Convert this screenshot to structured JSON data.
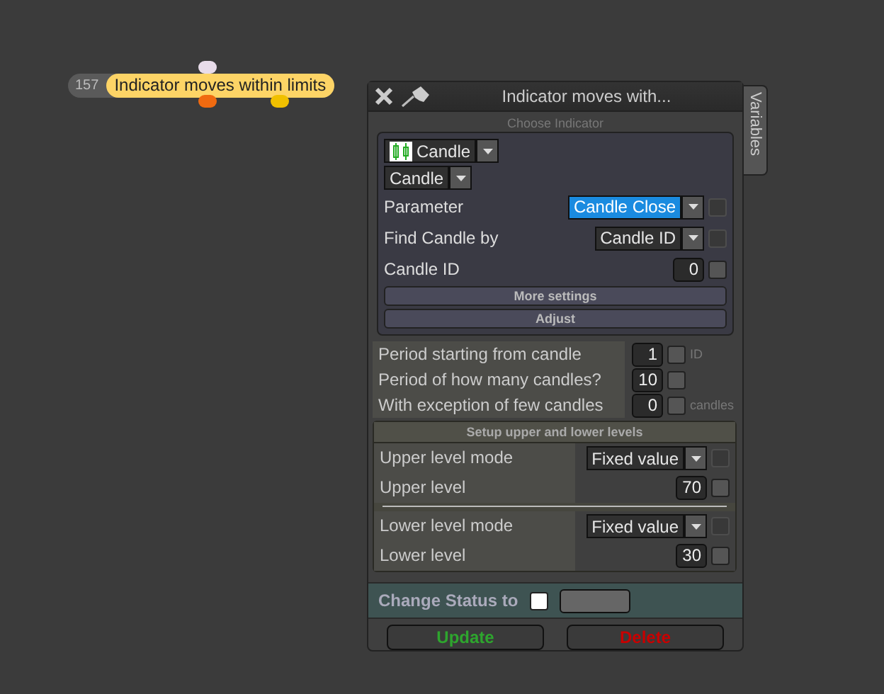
{
  "node": {
    "number": "157",
    "label": "Indicator moves within limits"
  },
  "panel": {
    "title": "Indicator moves with...",
    "side_tab": "Variables"
  },
  "indicator": {
    "caption": "Choose Indicator",
    "selects": [
      "Candle",
      "Candle"
    ],
    "rows": [
      {
        "kind": "dropdown",
        "label": "Parameter",
        "value": "Candle Close",
        "focused": true,
        "disabled": true
      },
      {
        "kind": "dropdown",
        "label": "Find Candle by",
        "value": "Candle ID",
        "focused": false,
        "disabled": true
      },
      {
        "kind": "number",
        "label": "Candle ID",
        "value": "0",
        "checked": false
      }
    ],
    "buttons": [
      "More settings",
      "Adjust"
    ]
  },
  "period": [
    {
      "label": "Period starting from candle",
      "value": "1",
      "checked": false,
      "unit": "ID"
    },
    {
      "label": "Period of how many candles?",
      "value": "10",
      "checked": false
    },
    {
      "label": "With exception of few candles",
      "value": "0",
      "checked": false,
      "unit": "candles"
    }
  ],
  "levels": {
    "title": "Setup upper and lower levels",
    "groups": [
      [
        {
          "kind": "dropdown",
          "label": "Upper level mode",
          "value": "Fixed value",
          "focused": false,
          "disabled": true
        },
        {
          "kind": "number",
          "label": "Upper level",
          "value": "70",
          "checked": false
        }
      ],
      [
        {
          "kind": "dropdown",
          "label": "Lower level mode",
          "value": "Fixed value",
          "focused": false,
          "disabled": true
        },
        {
          "kind": "number",
          "label": "Lower level",
          "value": "30",
          "checked": false
        }
      ]
    ]
  },
  "status": {
    "label": "Change Status to",
    "checked": false
  },
  "actions": [
    {
      "kind": "update",
      "label": "Update"
    },
    {
      "kind": "delete",
      "label": "Delete"
    }
  ]
}
